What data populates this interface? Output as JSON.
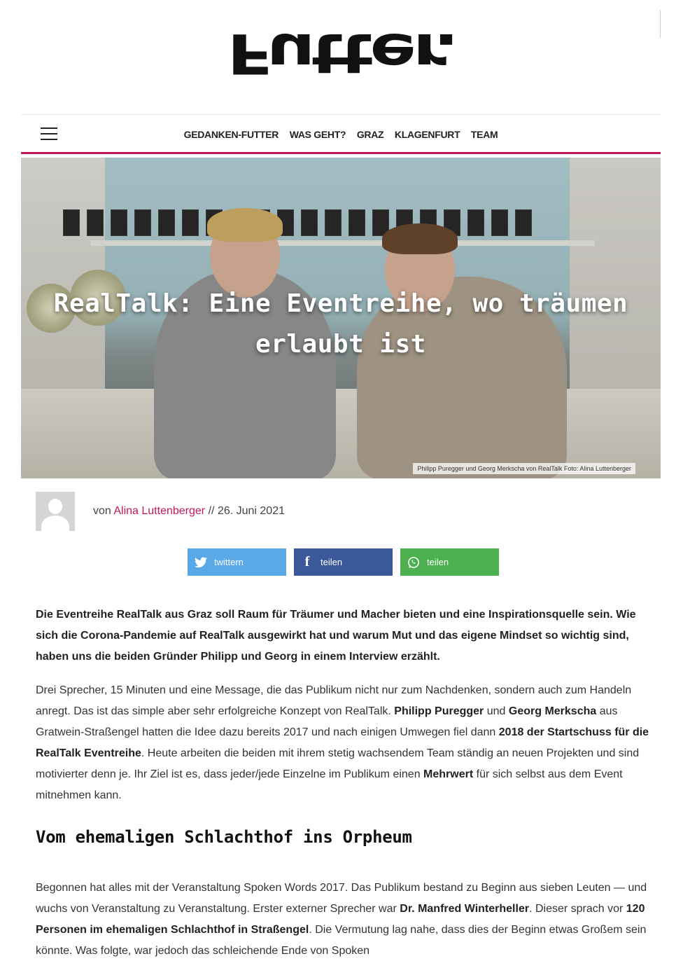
{
  "brand": {
    "logo_text": "Futter."
  },
  "nav": {
    "items": [
      "GEDANKEN-FUTTER",
      "WAS GEHT?",
      "GRAZ",
      "KLAGENFURT",
      "TEAM"
    ]
  },
  "hero": {
    "title_line1": "RealTalk: Eine Eventreihe, wo träumen",
    "title_line2": "erlaubt ist",
    "caption": "Philipp Puregger und Georg Merkscha von RealTalk Foto: Alina Luttenberger"
  },
  "author": {
    "prefix": "von",
    "name": "Alina Luttenberger",
    "separator": "//",
    "date": "26. Juni 2021"
  },
  "share": {
    "twitter_label": "twittern",
    "facebook_label": "teilen",
    "whatsapp_label": "teilen"
  },
  "article": {
    "lead": "Die Eventreihe RealTalk aus Graz soll Raum für Träumer und Macher bieten und eine Inspirationsquelle sein. Wie sich die Corona-Pandemie auf RealTalk ausgewirkt hat und warum Mut und das eigene Mindset so wichtig sind, haben uns die beiden Gründer Philipp und Georg in einem Interview erzählt.",
    "p1": {
      "a": "Drei Sprecher, 15 Minuten und eine Message, die das Publikum nicht nur zum Nachdenken, sondern auch zum Handeln anregt. Das ist das simple aber sehr erfolgreiche Konzept von RealTalk. ",
      "b1": "Philipp Puregger",
      "c": " und ",
      "b2": "Georg Merkscha",
      "d": " aus Gratwein-Straßengel hatten die Idee dazu bereits 2017 und nach einigen Umwegen fiel dann ",
      "b3": "2018 der Startschuss für die RealTalk Eventreihe",
      "e": ". Heute arbeiten die beiden mit ihrem stetig wachsendem Team ständig an neuen Projekten und sind motivierter denn je. Ihr Ziel ist es, dass jeder/jede Einzelne im Publikum einen ",
      "b4": "Mehrwert",
      "f": " für sich selbst aus dem Event mitnehmen kann."
    },
    "h2": "Vom ehemaligen Schlachthof ins Orpheum",
    "p2": {
      "a": "Begonnen hat alles mit der Veranstaltung Spoken Words 2017. Das Publikum bestand zu Beginn aus sieben Leuten — und wuchs von Veranstaltung zu Veranstaltung. Erster externer Sprecher war ",
      "b1": "Dr. Manfred Winterheller",
      "c": ". Dieser sprach vor ",
      "b2": "120 Personen im ehemaligen Schlachthof in Straßengel",
      "d": ". Die Vermutung lag nahe, dass dies der Beginn etwas Großem sein könnte. Was folgte, war jedoch das schleichende Ende von Spoken"
    }
  },
  "colors": {
    "accent": "#c2185b",
    "twitter": "#5aa9e6",
    "facebook": "#3b5998",
    "whatsapp": "#4caf50"
  }
}
